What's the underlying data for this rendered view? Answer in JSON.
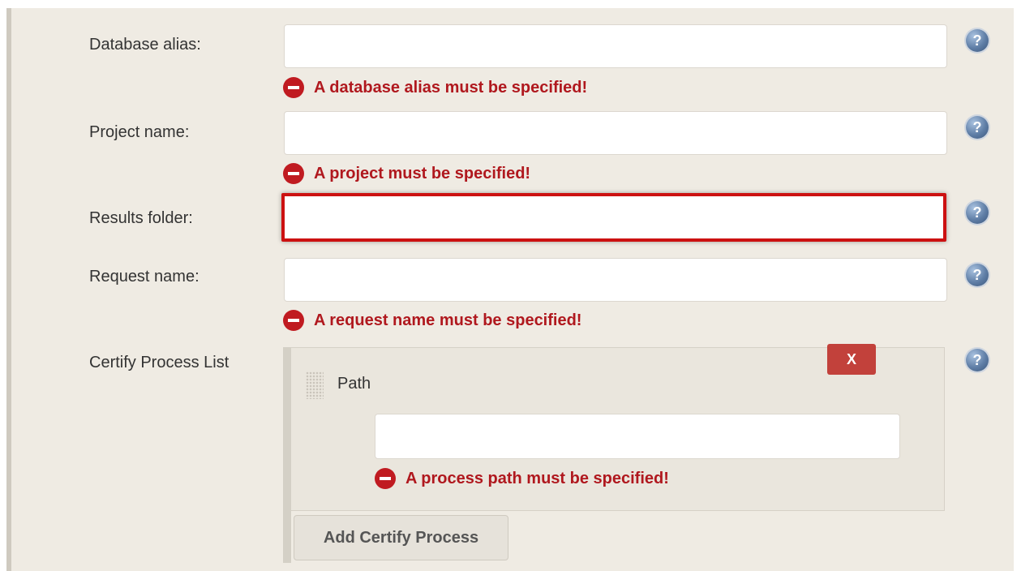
{
  "form": {
    "database_alias": {
      "label": "Database alias:",
      "value": "",
      "error": "A database alias must be specified!"
    },
    "project_name": {
      "label": "Project name:",
      "value": "",
      "error": "A project must be specified!"
    },
    "results_folder": {
      "label": "Results folder:",
      "value": ""
    },
    "request_name": {
      "label": "Request name:",
      "value": "",
      "error": "A request name must be specified!"
    },
    "certify_process_list": {
      "label": "Certify Process List",
      "delete_label": "X",
      "path_label": "Path",
      "path_value": "",
      "path_error": "A process path must be specified!",
      "add_label": "Add Certify Process"
    },
    "help_glyph": "?"
  },
  "colors": {
    "error_text": "#b0181e",
    "highlight_border": "#cc1111",
    "delete_button": "#c2413b",
    "panel_bg": "#efebe3"
  },
  "icons": [
    "help-icon",
    "error-icon",
    "drag-handle-icon"
  ]
}
